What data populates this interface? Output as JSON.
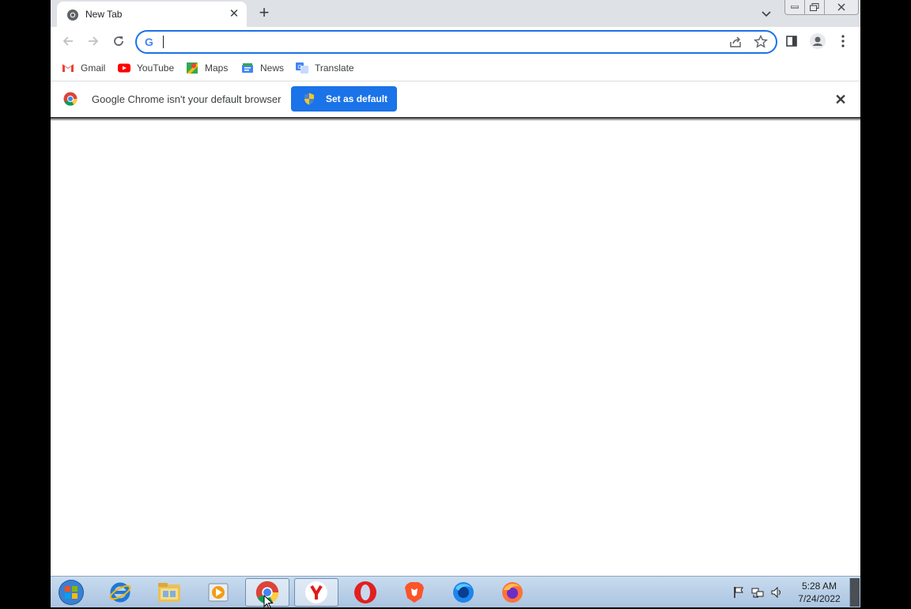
{
  "browser": {
    "tab_title": "New Tab",
    "address_value": "",
    "bookmarks": [
      {
        "label": "Gmail",
        "icon": "gmail-icon"
      },
      {
        "label": "YouTube",
        "icon": "youtube-icon"
      },
      {
        "label": "Maps",
        "icon": "maps-icon"
      },
      {
        "label": "News",
        "icon": "news-icon"
      },
      {
        "label": "Translate",
        "icon": "translate-icon"
      }
    ],
    "infobar": {
      "message": "Google Chrome isn't your default browser",
      "button_label": "Set as default"
    }
  },
  "taskbar": {
    "apps": [
      {
        "name": "internet-explorer",
        "icon": "ie-icon"
      },
      {
        "name": "file-explorer",
        "icon": "folder-icon"
      },
      {
        "name": "media-player",
        "icon": "media-player-icon"
      },
      {
        "name": "chrome",
        "icon": "chrome-icon",
        "active": true
      },
      {
        "name": "yandex",
        "icon": "yandex-icon"
      },
      {
        "name": "opera",
        "icon": "opera-icon"
      },
      {
        "name": "brave",
        "icon": "brave-icon"
      },
      {
        "name": "firefox-developer",
        "icon": "firefox-blue-icon"
      },
      {
        "name": "firefox",
        "icon": "firefox-icon"
      }
    ],
    "clock": {
      "time": "5:28 AM",
      "date": "7/24/2022"
    }
  },
  "colors": {
    "accent": "#1a73e8",
    "tabstrip": "#dee1e6",
    "taskbar": "#b9d0e8"
  }
}
